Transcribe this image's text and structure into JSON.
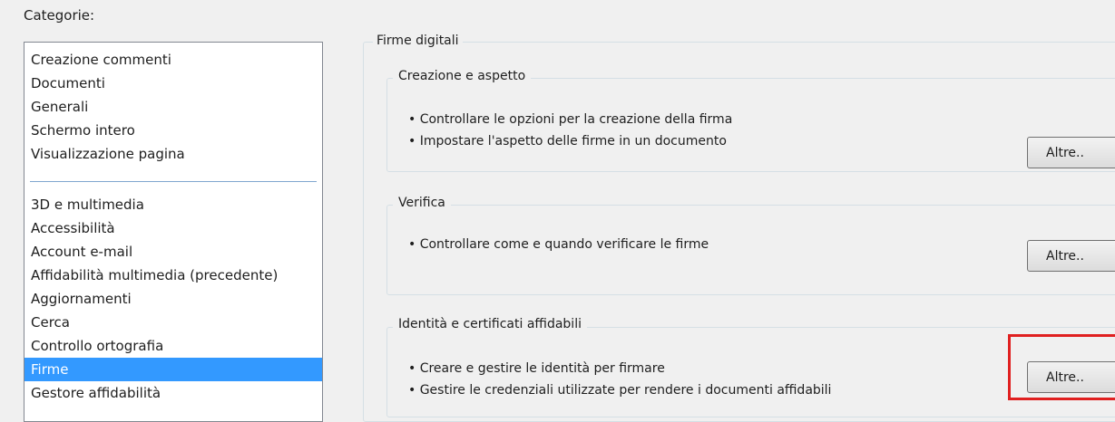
{
  "categories": {
    "label": "Categorie:",
    "group_top": [
      "Creazione commenti",
      "Documenti",
      "Generali",
      "Schermo intero",
      "Visualizzazione pagina"
    ],
    "group_bottom": [
      "3D e multimedia",
      "Accessibilità",
      "Account e-mail",
      "Affidabilità multimedia (precedente)",
      "Aggiornamenti",
      "Cerca",
      "Controllo ortografia",
      "Firme",
      "Gestore affidabilità"
    ],
    "selected": "Firme"
  },
  "panel": {
    "title": "Firme digitali",
    "sections": [
      {
        "title": "Creazione e aspetto",
        "bullets": [
          "• Controllare le opzioni per la creazione della firma",
          "• Impostare l'aspetto delle firme in un documento"
        ],
        "button": "Altre.."
      },
      {
        "title": "Verifica",
        "bullets": [
          "• Controllare come e quando verificare le firme"
        ],
        "button": "Altre.."
      },
      {
        "title": "Identità e certificati affidabili",
        "bullets": [
          "• Creare e gestire le identità per firmare",
          "• Gestire le credenziali utilizzate per rendere i documenti affidabili"
        ],
        "button": "Altre.."
      }
    ]
  },
  "colors": {
    "selection": "#3399ff",
    "highlight": "#e02020"
  }
}
